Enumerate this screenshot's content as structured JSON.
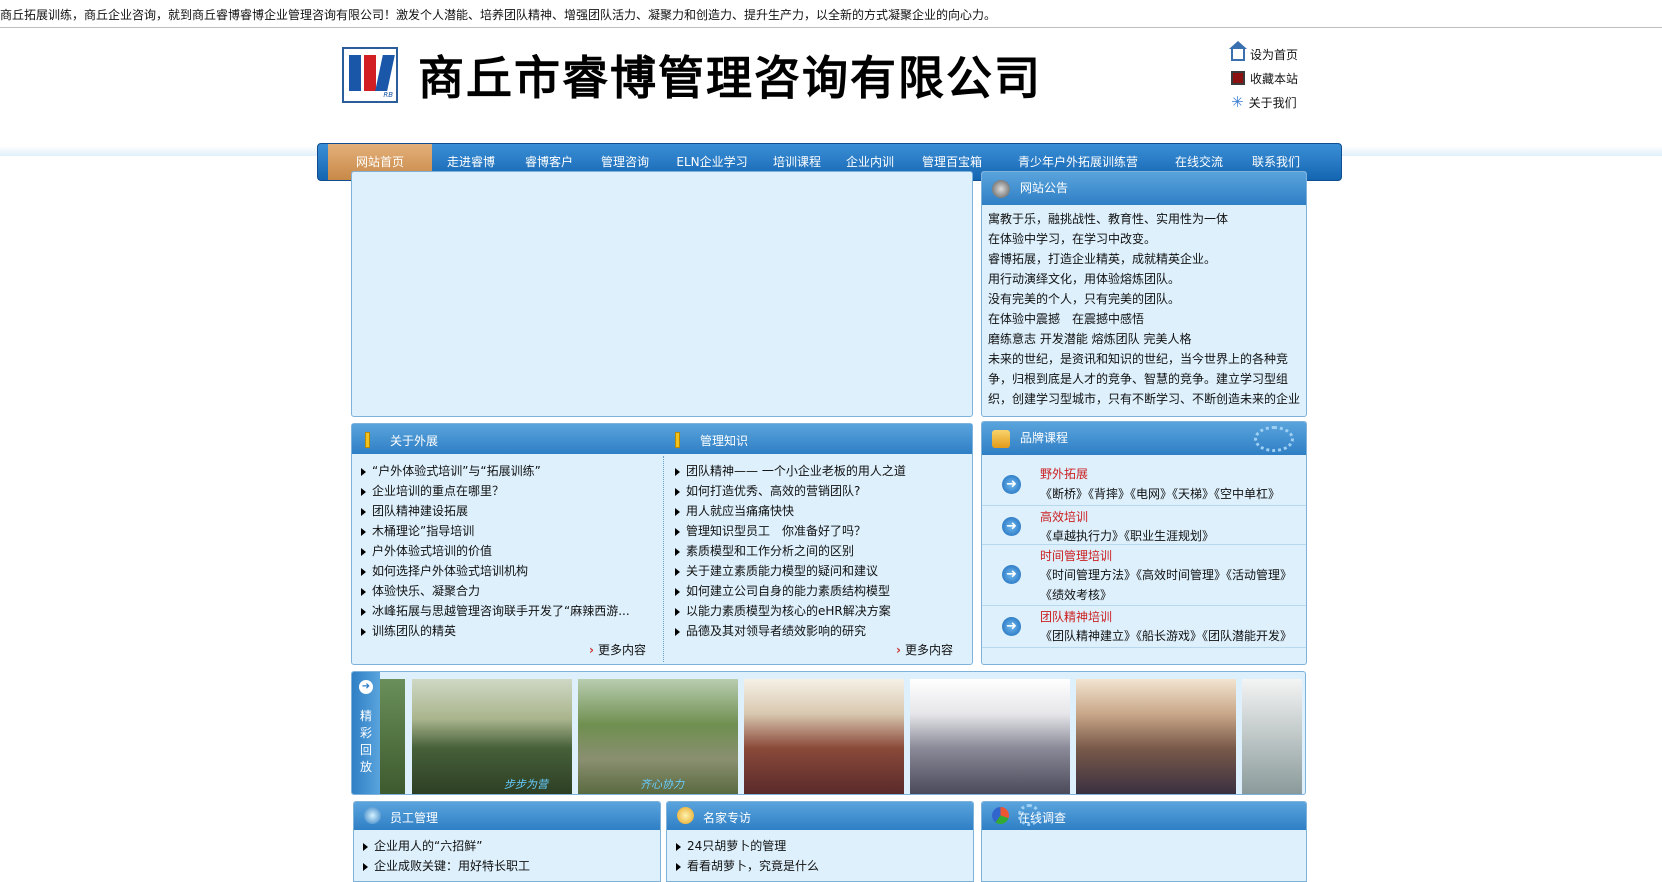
{
  "top_tagline": "商丘拓展训练，商丘企业咨询，就到商丘睿博睿博企业管理咨询有限公司！激发个人潜能、培养团队精神、增强团队活力、凝聚力和创造力、提升生产力，以全新的方式凝聚企业的向心力。",
  "company_name": "商丘市睿博管理咨询有限公司",
  "logo_text": "RB",
  "quick_links": [
    "设为首页",
    "收藏本站",
    "关于我们"
  ],
  "nav": [
    "网站首页",
    "走进睿博",
    "睿博客户",
    "管理咨询",
    "ELN企业学习",
    "培训课程",
    "企业内训",
    "管理百宝箱",
    "青少年户外拓展训练营",
    "在线交流",
    "联系我们"
  ],
  "notice": {
    "title": "网站公告",
    "lines": [
      "寓教于乐，融挑战性、教育性、实用性为一体",
      "在体验中学习，在学习中改变。",
      "睿博拓展，打造企业精英，成就精英企业。",
      "用行动演绎文化，用体验熔炼团队。",
      "没有完美的个人，只有完美的团队。",
      "在体验中震撼　在震撼中感悟",
      "磨练意志 开发潜能 熔炼团队 完美人格"
    ],
    "para": "未来的世纪，是资讯和知识的世纪，当今世界上的各种竞争，归根到底是人才的竞争、智慧的竞争。建立学习型组织，创建学习型城市，只有不断学习、不断创造未来的企业"
  },
  "about": {
    "title": "关于外展",
    "items": [
      "“户外体验式培训”与“拓展训练”",
      "企业培训的重点在哪里？",
      "团队精神建设拓展",
      "木桶理论”指导培训",
      "户外体验式培训的价值",
      "如何选择户外体验式培训机构",
      "体验快乐、凝聚合力",
      "冰峰拓展与思越管理咨询联手开发了“麻辣西游...",
      "训练团队的精英"
    ],
    "more": "更多内容"
  },
  "knowledge": {
    "title": "管理知识",
    "items": [
      "团队精神—— 一个小企业老板的用人之道",
      "如何打造优秀、高效的营销团队?",
      "用人就应当痛痛快快",
      "管理知识型员工　你准备好了吗？",
      "素质模型和工作分析之间的区别",
      "关于建立素质能力模型的疑问和建议",
      "如何建立公司自身的能力素质结构模型",
      "以能力素质模型为核心的eHR解决方案",
      "品德及其对领导者绩效影响的研究"
    ],
    "more": "更多内容"
  },
  "brand": {
    "title": "品牌课程",
    "courses": [
      {
        "name": "野外拓展",
        "desc": [
          "《断桥》《背摔》《电网》《天梯》《空中单杠》"
        ]
      },
      {
        "name": "高效培训",
        "desc": [
          "《卓越执行力》《职业生涯规划》"
        ]
      },
      {
        "name": "时间管理培训",
        "desc": [
          "《时间管理方法》《高效时间管理》《活动管理》",
          "《绩效考核》"
        ]
      },
      {
        "name": "团队精神培训",
        "desc": [
          "《团队精神建立》《船长游戏》《团队潜能开发》"
        ]
      }
    ]
  },
  "gallery": {
    "label": "精彩回放",
    "captions": [
      "步步为营",
      "齐心协力"
    ]
  },
  "staff": {
    "title": "员工管理",
    "items": [
      "企业用人的“六招鲜”",
      "企业成败关键：用好特长职工"
    ]
  },
  "experts": {
    "title": "名家专访",
    "items": [
      "24只胡萝卜的管理",
      "看看胡萝卜，究竟是什么"
    ]
  },
  "survey": {
    "title": "在线调查"
  },
  "colors": {
    "nav_blue": "#1565b2",
    "active_tab": "#c88948",
    "panel_bg": "#ddf0fc",
    "course_red": "#cc1f1f"
  }
}
